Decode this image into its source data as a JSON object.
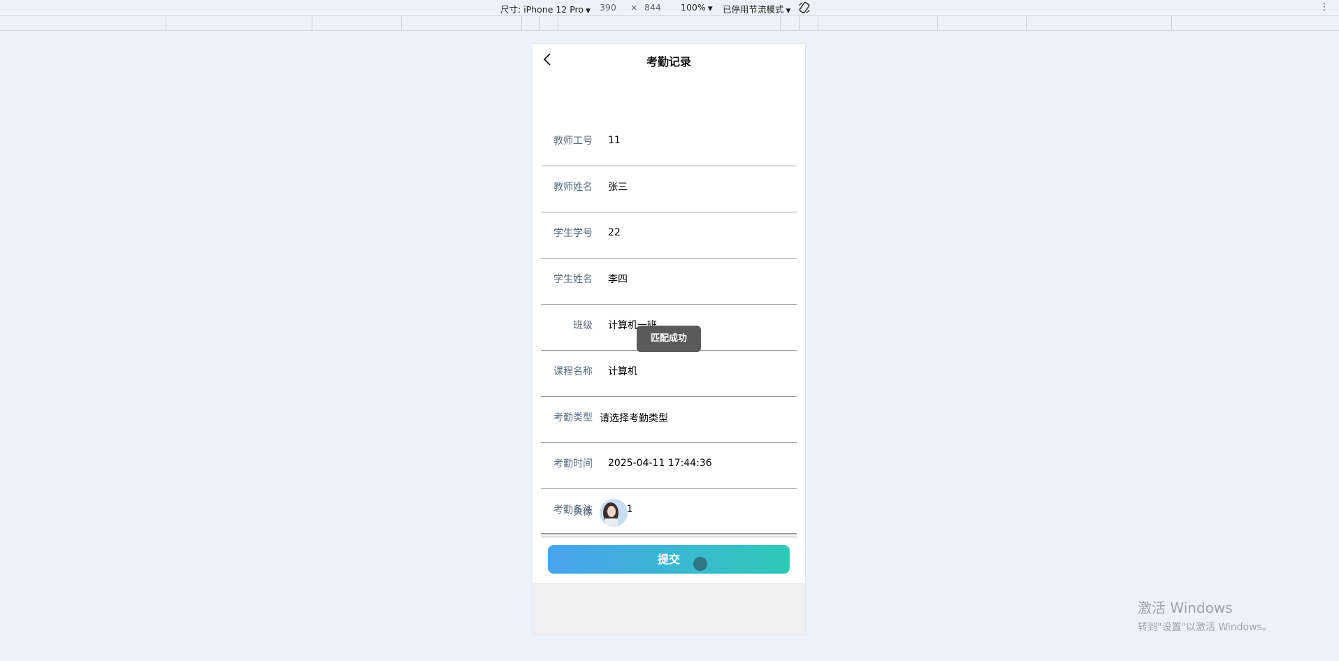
{
  "devtools": {
    "size_label": "尺寸: iPhone 12 Pro",
    "width": "390",
    "times": "×",
    "height": "844",
    "zoom": "100%",
    "throttle": "已停用节流模式",
    "rotate_icon": "rotate-icon",
    "more_icon": "kebab-icon"
  },
  "nav": {
    "title": "考勤记录",
    "back_icon": "chevron-left-icon"
  },
  "form": {
    "fields": [
      {
        "label": "教师工号",
        "value": "11"
      },
      {
        "label": "教师姓名",
        "value": "张三"
      },
      {
        "label": "学生学号",
        "value": "22"
      },
      {
        "label": "学生姓名",
        "value": "李四"
      },
      {
        "label": "班级",
        "value": "计算机一班"
      },
      {
        "label": "课程名称",
        "value": "计算机"
      },
      {
        "label": "考勤类型",
        "value": "请选择考勤类型"
      },
      {
        "label": "考勤时间",
        "value": "2025-04-11 17:44:36"
      },
      {
        "label": "考勤备注",
        "value": "1111"
      },
      {
        "label": "头像",
        "value": ""
      }
    ],
    "submit_label": "提交"
  },
  "toast": {
    "text": "匹配成功"
  },
  "watermark": {
    "line1": "激活 Windows",
    "line2": "转到\"设置\"以激活 Windows。"
  },
  "colors": {
    "accent_start": "#49a3ee",
    "accent_end": "#2ec9b8",
    "label": "#5a6b80"
  }
}
